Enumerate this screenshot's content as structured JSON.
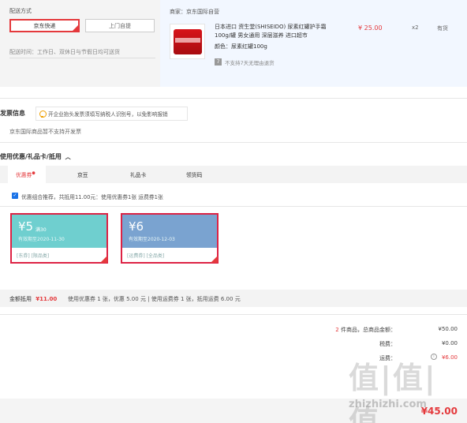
{
  "shipping": {
    "title": "配送方式",
    "options": [
      "京东快递",
      "上门自提"
    ],
    "time_label": "配送时间：",
    "time_value": "工作日、双休日与节假日均可送货"
  },
  "seller": {
    "label": "商家：",
    "name": "京东国际自营"
  },
  "product": {
    "name": "日本进口 资生堂(SHISEIDO) 尿素红罐护手霜 100g/罐 男女通用 深层滋养 进口超市",
    "color_label": "颜色：",
    "color_value": "尿素红罐100g",
    "price": "¥ 25.00",
    "qty": "x2",
    "stock": "有货",
    "return_note": "不支持7天无理由退货"
  },
  "invoice": {
    "title": "发票信息",
    "tip": "开企业抬头发票须填写纳税人识别号，以免影响报销",
    "note": "京东国际商品暂不支持开发票"
  },
  "discount": {
    "title": "使用优惠/礼品卡/抵用",
    "tabs": [
      "优惠券",
      "京豆",
      "礼品卡",
      "领货码"
    ],
    "recommend": "优惠组合推荐，共抵用11.00元：使用优惠券1张 运费券1张",
    "coupons": [
      {
        "amount": "¥5",
        "condition": "满30",
        "expire": "有效期至2020-11-30",
        "tags": "[东券]  [限品类]",
        "color": "#6fcfcf"
      },
      {
        "amount": "¥6",
        "condition": "",
        "expire": "有效期至2020-12-03",
        "tags": "[运费券]  [全品类]",
        "color": "#7aa3d0"
      }
    ],
    "summary_label": "金额抵用",
    "summary_amount": "¥11.00",
    "summary_detail": "使用优惠券 1 张，优惠 5.00 元  | 使用运费券 1 张，抵用运费 6.00 元"
  },
  "totals": {
    "items_prefix": "2",
    "items_label": "件商品，总商品金额：",
    "items_value": "¥50.00",
    "tax_label": "税费：",
    "tax_value": "¥0.00",
    "freight_label": "运费：",
    "freight_value": "¥6.00",
    "final_value": "¥45.00"
  },
  "watermark": {
    "main": "值|值|值",
    "site": "zhizhizhi.com"
  },
  "colors": {
    "accent": "#e4393c"
  }
}
